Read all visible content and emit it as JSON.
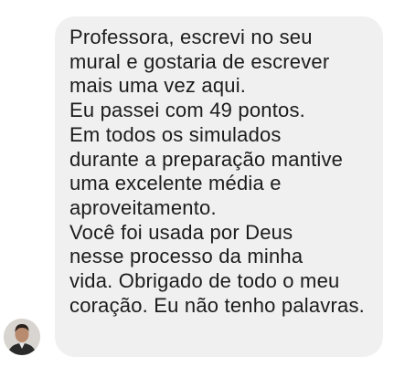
{
  "message": {
    "lines": [
      "Professora, escrevi no seu",
      "mural e gostaria de escrever",
      "mais uma vez aqui.",
      "Eu passei com 49 pontos.",
      "Em todos os simulados",
      "durante a preparação mantive",
      "uma excelente média e",
      "aproveitamento.",
      "Você foi usada por Deus",
      "nesse processo da minha",
      "vida. Obrigado de todo o meu",
      "coração. Eu não tenho palavras."
    ]
  },
  "colors": {
    "bubble_background": "#f0f0f0",
    "text": "#1c1c1c"
  },
  "icons": {
    "avatar": "user-avatar-photo"
  }
}
